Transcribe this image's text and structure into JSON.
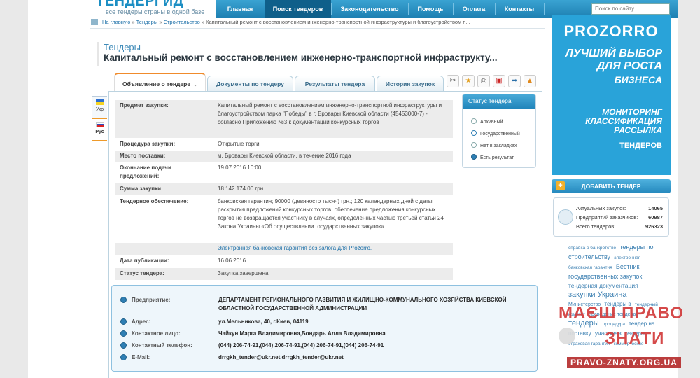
{
  "header": {
    "logo_name": "ТЕНДЕРГИД",
    "logo_tagline": "все тендеры страны в одной базе",
    "nav": [
      "Главная",
      "Поиск тендеров",
      "Законодательство",
      "Помощь",
      "Оплата",
      "Контакты"
    ],
    "nav_active": 1,
    "search_placeholder": "Поиск по сайту"
  },
  "breadcrumb": {
    "items": [
      "На главную",
      "Тендеры",
      "Строительство"
    ],
    "current": "Капитальный ремонт с восстановлением инженерно-транспортной инфраструктуры и благоустройством п..."
  },
  "page": {
    "section": "Тендеры",
    "title": "Капитальный ремонт с восстановлением инженерно-транспортной инфраструкту..."
  },
  "lang_tabs": [
    "Укр",
    "Рус"
  ],
  "tabs": [
    "Объявление о тендере",
    "Документы по тендеру",
    "Результаты тендера",
    "История закупок"
  ],
  "tender": {
    "rows": [
      {
        "label": "Предмет закупки:",
        "value": "Капитальный ремонт с восстановлением инженерно-транспортной инфраструктуры и благоустройством парка \"Победы\" в г. Бровары Киевской области (45453000-7) - согласно Приложению №3 к документации конкурсных торгов"
      },
      {
        "label": "Процедура закупки:",
        "value": "Открытые торги"
      },
      {
        "label": "Место поставки:",
        "value": "м. Бровары Киевской области, в течение 2016 года"
      },
      {
        "label": "Окончание подачи предложений:",
        "value": "19.07.2016 10:00"
      },
      {
        "label": "Сумма закупки",
        "value": "18 142 174.00 грн."
      },
      {
        "label": "Тендерное обеспечение:",
        "value": "банковская гарантия; 90000 (девяносто тысяч) грн.; 120 календарных дней с даты раскрытия предложений конкурсных торгов; обеспечение предложения конкурсных торгов не возвращается участнику в случаях, определенных частью третьей статьи 24 Закона Украины «Об осуществлении государственных закупок»"
      },
      {
        "label": "",
        "value": "Электронная банковская гарантия без залога для Prozorro."
      },
      {
        "label": "Дата публикации:",
        "value": "16.06.2016"
      },
      {
        "label": "Статус тендера:",
        "value": "Закупка завершена"
      }
    ]
  },
  "status_box": {
    "title": "Статус тендера",
    "items": [
      "Архивный",
      "Государственный",
      "Нет в закладках",
      "Есть результат"
    ]
  },
  "organizer": {
    "rows": [
      {
        "label": "Предприятие:",
        "value": "ДЕПАРТАМЕНТ РЕГИОНАЛЬНОГО РАЗВИТИЯ И ЖИЛИЩНО-КОММУНАЛЬНОГО ХОЗЯЙСТВА КИЕВСКОЙ ОБЛАСТНОЙ ГОСУДАРСТВЕННОЙ АДМИНИСТРАЦИИ"
      },
      {
        "label": "Адрес:",
        "value": "ул.Мельникова, 40, г.Киев, 04119"
      },
      {
        "label": "Контактное лицо:",
        "value": "Чайкун Марга Владимировна,Бондарь Алла Владимировна"
      },
      {
        "label": "Контактный телефон:",
        "value": "(044) 206-74-91,(044) 206-74-91,(044) 206-74-91,(044) 206-74-91"
      },
      {
        "label": "E-Mail:",
        "value": "drrgkh_tender@ukr.net,drrgkh_tender@ukr.net"
      }
    ]
  },
  "sidebar": {
    "banner": {
      "brand": "PROZORRO",
      "line1": "ЛУЧШИЙ ВЫБОР ДЛЯ РОСТА",
      "line2": "БИЗНЕСА",
      "line3": "МОНИТОРИНГ КЛАССИФИКАЦИЯ РАССЫЛКА",
      "line4": "ТЕНДЕРОВ"
    },
    "add_tender": "ДОБАВИТЬ ТЕНДЕР",
    "stats": [
      {
        "label": "Актуальных закупок:",
        "value": "14065"
      },
      {
        "label": "Предприятий заказчиков:",
        "value": "60987"
      },
      {
        "label": "Всего тендеров:",
        "value": "926323"
      }
    ],
    "tags": [
      "справка о банкротстве",
      "тендеры по строительству",
      "электронная банковская гарантия",
      "Вестник государственных закупок",
      "тендерная документация",
      "закупки Украина",
      "Министерство",
      "тендеры в",
      "тендерный комитет",
      "проведение тендера",
      "тендеры",
      "процедура",
      "тендер на поставку",
      "участие в",
      "тендеры",
      "страховая гарантия",
      "коммерческие"
    ]
  },
  "watermark": {
    "line1": "МАЄШ ПРАВО",
    "line2": "ЗНАТИ",
    "url": "PRAVO-ZNATY.ORG.UA"
  }
}
